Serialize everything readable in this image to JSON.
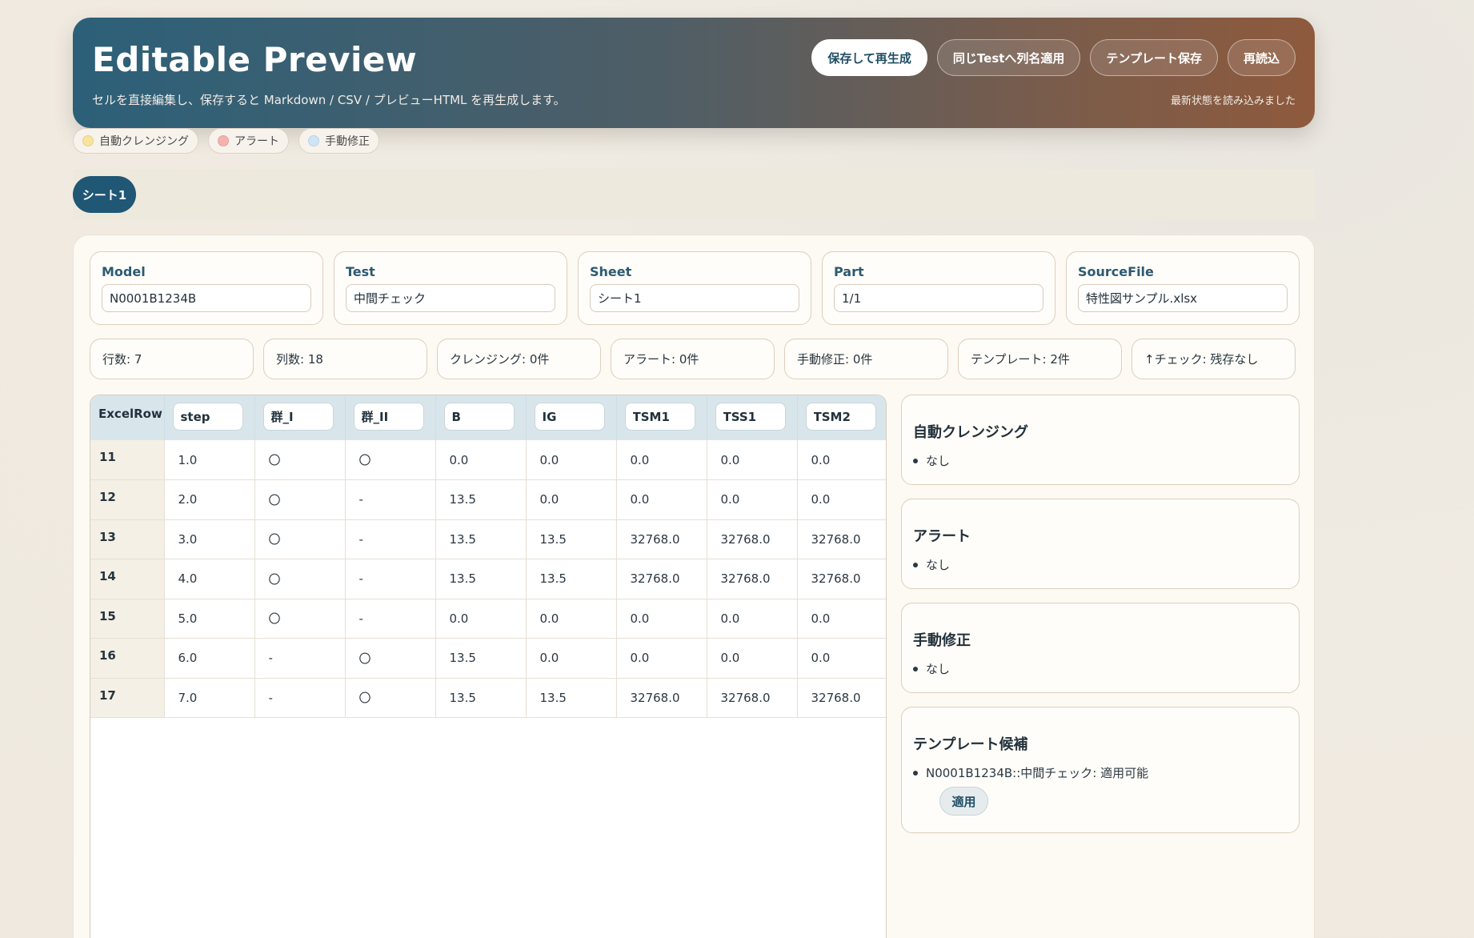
{
  "header": {
    "title": "Editable Preview",
    "subtitle": "セルを直接編集し、保存すると Markdown / CSV / プレビューHTML を再生成します。",
    "status": "最新状態を読み込みました",
    "buttons": {
      "save": "保存して再生成",
      "apply_names": "同じTestへ列名適用",
      "template_save": "テンプレート保存",
      "reload": "再読込"
    }
  },
  "legend": [
    {
      "label": "自動クレンジング",
      "color": "#f8e49a"
    },
    {
      "label": "アラート",
      "color": "#f4b3ae"
    },
    {
      "label": "手動修正",
      "color": "#cfe4f6"
    }
  ],
  "tabs": [
    {
      "label": "シート1"
    }
  ],
  "meta": {
    "model": {
      "label": "Model",
      "value": "N0001B1234B"
    },
    "test": {
      "label": "Test",
      "value": "中間チェック"
    },
    "sheet": {
      "label": "Sheet",
      "value": "シート1"
    },
    "part": {
      "label": "Part",
      "value": "1/1"
    },
    "source": {
      "label": "SourceFile",
      "value": "特性図サンプル.xlsx"
    }
  },
  "stats": [
    "行数: 7",
    "列数: 18",
    "クレンジング: 0件",
    "アラート: 0件",
    "手動修正: 0件",
    "テンプレート: 2件",
    "↑チェック: 残存なし"
  ],
  "table": {
    "row_header": "ExcelRow",
    "columns": [
      "step",
      "群_I",
      "群_II",
      "B",
      "IG",
      "TSM1",
      "TSS1",
      "TSM2"
    ],
    "rows": [
      {
        "excel_row": "11",
        "cells": [
          "1.0",
          "〇",
          "〇",
          "0.0",
          "0.0",
          "0.0",
          "0.0",
          "0.0"
        ]
      },
      {
        "excel_row": "12",
        "cells": [
          "2.0",
          "〇",
          "-",
          "13.5",
          "0.0",
          "0.0",
          "0.0",
          "0.0"
        ]
      },
      {
        "excel_row": "13",
        "cells": [
          "3.0",
          "〇",
          "-",
          "13.5",
          "13.5",
          "32768.0",
          "32768.0",
          "32768.0"
        ]
      },
      {
        "excel_row": "14",
        "cells": [
          "4.0",
          "〇",
          "-",
          "13.5",
          "13.5",
          "32768.0",
          "32768.0",
          "32768.0"
        ]
      },
      {
        "excel_row": "15",
        "cells": [
          "5.0",
          "〇",
          "-",
          "0.0",
          "0.0",
          "0.0",
          "0.0",
          "0.0"
        ]
      },
      {
        "excel_row": "16",
        "cells": [
          "6.0",
          "-",
          "〇",
          "13.5",
          "0.0",
          "0.0",
          "0.0",
          "0.0"
        ]
      },
      {
        "excel_row": "17",
        "cells": [
          "7.0",
          "-",
          "〇",
          "13.5",
          "13.5",
          "32768.0",
          "32768.0",
          "32768.0"
        ]
      }
    ]
  },
  "side": {
    "cleansing": {
      "title": "自動クレンジング",
      "items": [
        "なし"
      ]
    },
    "alerts": {
      "title": "アラート",
      "items": [
        "なし"
      ]
    },
    "manual": {
      "title": "手動修正",
      "items": [
        "なし"
      ]
    },
    "templates": {
      "title": "テンプレート候補",
      "items": [
        "N0001B1234B::中間チェック: 適用可能"
      ],
      "apply_label": "適用"
    }
  }
}
